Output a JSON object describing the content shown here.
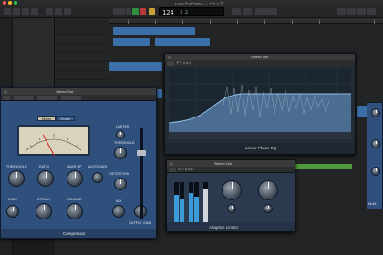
{
  "window": {
    "title": "Logic Pro Project — トラック"
  },
  "transport": {
    "lcd_value": "124",
    "lcd_sub": "3 2"
  },
  "colors": {
    "accent_blue": "#3a9bd8",
    "region_blue": "#3b6fa8",
    "region_green": "#4f9a3c",
    "compressor_face": "#2f4f7d",
    "eq_curve": "#8fbce6"
  },
  "compressor": {
    "title": "Stereo Out",
    "name": "Compressor",
    "meter_tabs": [
      "Meter",
      "Graph"
    ],
    "knob_labels": [
      "THRESHOLD",
      "RATIO",
      "MAKE UP",
      "AUTO GAIN",
      "KNEE",
      "ATTACK",
      "RELEASE",
      "DISTORTION",
      "MIX",
      "OUTPUT GAIN"
    ],
    "side_labels": [
      "LIMITER",
      "THRESHOLD"
    ]
  },
  "eq": {
    "title": "Stereo Out",
    "preset": "デフォルト",
    "name": "Linear Phase EQ"
  },
  "limiter": {
    "title": "Stereo Out",
    "preset": "デフォルト",
    "name": "Adaptive Limiter"
  },
  "right_plugin": {
    "name": "Multi"
  }
}
